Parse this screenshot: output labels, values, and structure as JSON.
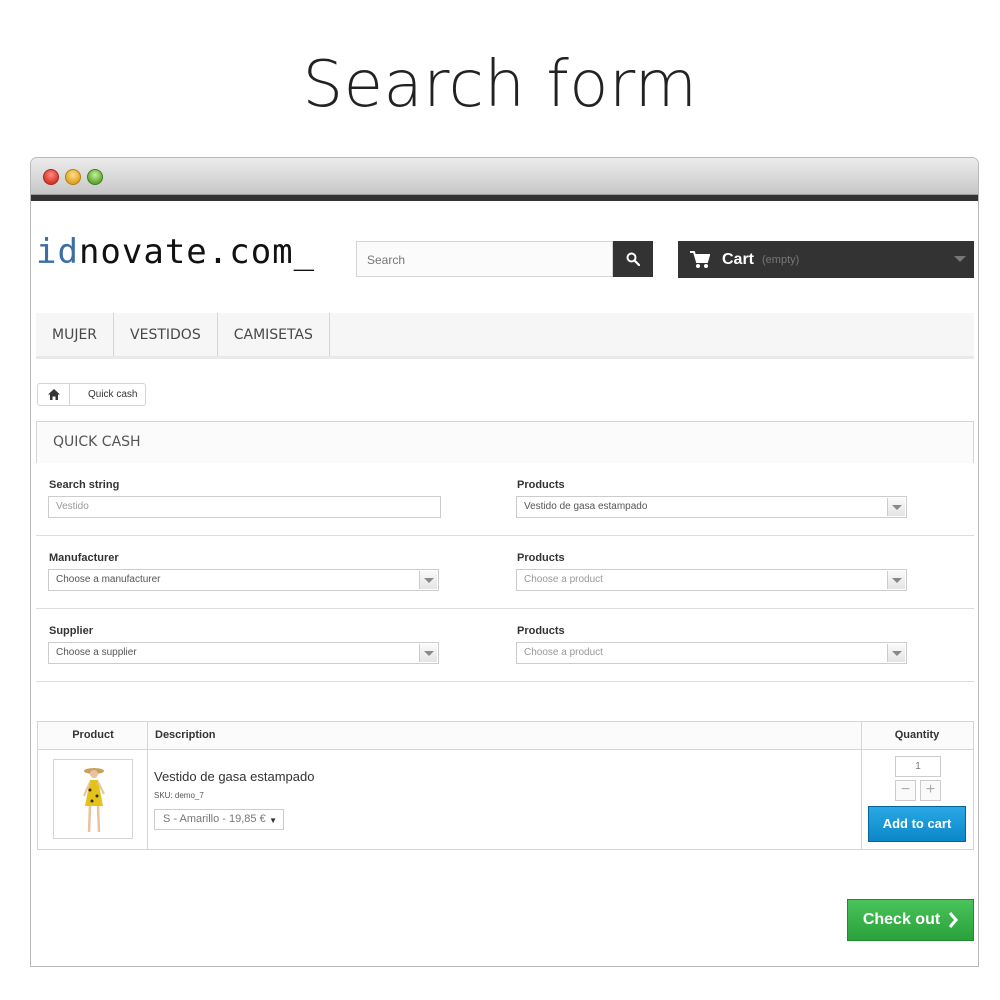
{
  "hero": {
    "title": "Search form"
  },
  "header": {
    "logo_prefix": "id",
    "logo_rest": "novate.com_",
    "search_placeholder": "Search",
    "cart_label": "Cart",
    "cart_status": "(empty)"
  },
  "menu": {
    "items": [
      "MUJER",
      "VESTIDOS",
      "CAMISETAS"
    ]
  },
  "breadcrumb": {
    "current": "Quick cash"
  },
  "page": {
    "heading": "QUICK CASH"
  },
  "form": {
    "rows": [
      {
        "left_label": "Search string",
        "left_value": "Vestido",
        "right_label": "Products",
        "right_value": "Vestido de gasa estampado"
      },
      {
        "left_label": "Manufacturer",
        "left_value": "Choose a manufacturer",
        "right_label": "Products",
        "right_value": "Choose a product"
      },
      {
        "left_label": "Supplier",
        "left_value": "Choose a supplier",
        "right_label": "Products",
        "right_value": "Choose a product"
      }
    ]
  },
  "table": {
    "headers": {
      "product": "Product",
      "description": "Description",
      "quantity": "Quantity"
    },
    "row": {
      "name": "Vestido de gasa estampado",
      "sku": "SKU: demo_7",
      "variant": "S - Amarillo - 19,85 €",
      "quantity": "1",
      "minus": "−",
      "plus": "+",
      "add_to_cart": "Add to cart"
    }
  },
  "checkout": {
    "label": "Check out"
  },
  "colors": {
    "cart_bg": "#333333",
    "add_to_cart": "#0b87c8",
    "checkout": "#2aa13b",
    "logo_accent": "#3a6ea5"
  }
}
